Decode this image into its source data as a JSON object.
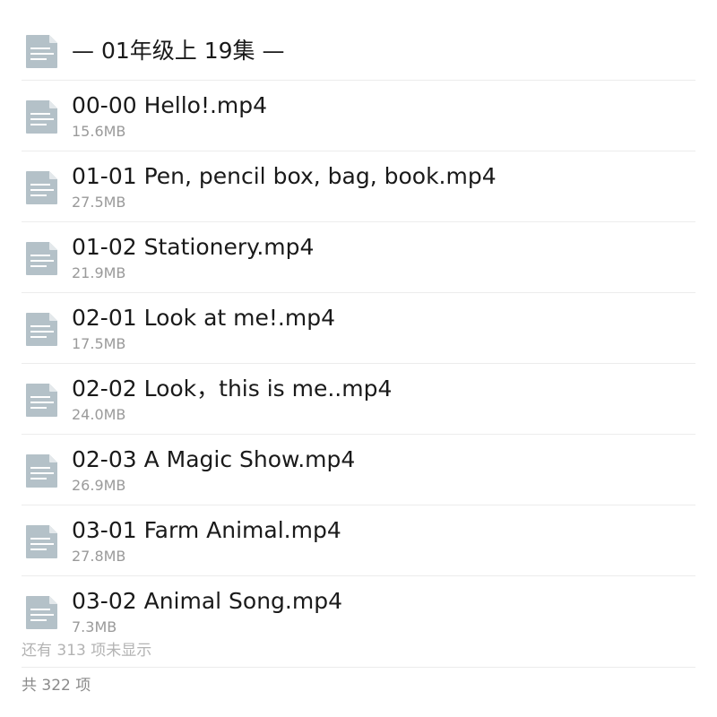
{
  "folder": {
    "title": "— 01年级上 19集 —",
    "icon": "document-icon"
  },
  "files": [
    {
      "name": "00-00 Hello!.mp4",
      "size": "15.6MB",
      "icon": "document-icon"
    },
    {
      "name": "01-01 Pen, pencil box, bag, book.mp4",
      "size": "27.5MB",
      "icon": "document-icon"
    },
    {
      "name": "01-02 Stationery.mp4",
      "size": "21.9MB",
      "icon": "document-icon"
    },
    {
      "name": "02-01 Look at me!.mp4",
      "size": "17.5MB",
      "icon": "document-icon"
    },
    {
      "name": "02-02 Look，this is me..mp4",
      "size": "24.0MB",
      "icon": "document-icon"
    },
    {
      "name": "02-03 A Magic Show.mp4",
      "size": "26.9MB",
      "icon": "document-icon"
    },
    {
      "name": "03-01 Farm Animal.mp4",
      "size": "27.8MB",
      "icon": "document-icon"
    },
    {
      "name": "03-02 Animal Song.mp4",
      "size": "7.3MB",
      "icon": "document-icon"
    }
  ],
  "footer": {
    "more_note": "还有 313 项未显示",
    "total": "共 322 项"
  },
  "colors": {
    "icon_fill": "#b4c1c8",
    "icon_fold": "#e3e8eb",
    "icon_lines": "#ffffff",
    "divider": "#ececec",
    "secondary_text": "#9a9a9a"
  }
}
